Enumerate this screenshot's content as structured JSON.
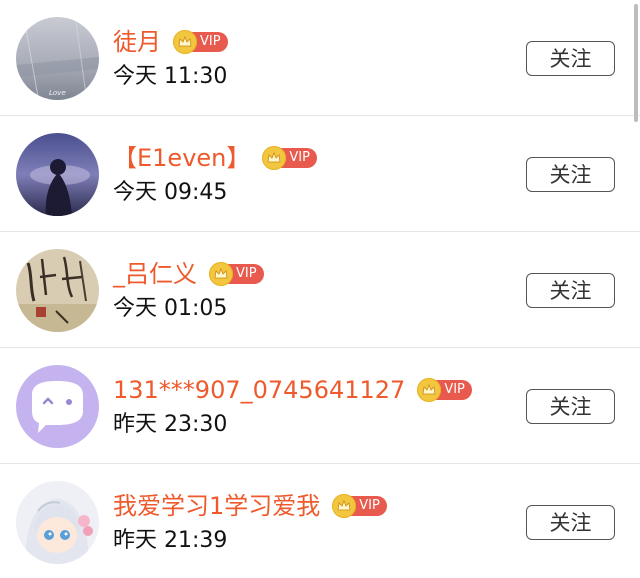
{
  "users": [
    {
      "name": "徒月",
      "time": "今天 11:30",
      "vip": "VIP",
      "follow": "关注"
    },
    {
      "name": "【E1even】",
      "time": "今天 09:45",
      "vip": "VIP",
      "follow": "关注"
    },
    {
      "name": "_吕仁义",
      "time": "今天 01:05",
      "vip": "VIP",
      "follow": "关注"
    },
    {
      "name": "131***907_0745641127",
      "time": "昨天 23:30",
      "vip": "VIP",
      "follow": "关注"
    },
    {
      "name": "我爱学习1学习爱我",
      "time": "昨天 21:39",
      "vip": "VIP",
      "follow": "关注"
    }
  ],
  "avatar_watermark": "Love",
  "colors": {
    "name": "#ee5a2c",
    "vip_badge": "#e85a4d",
    "crown": "#f3c640",
    "button_border": "#555555"
  }
}
